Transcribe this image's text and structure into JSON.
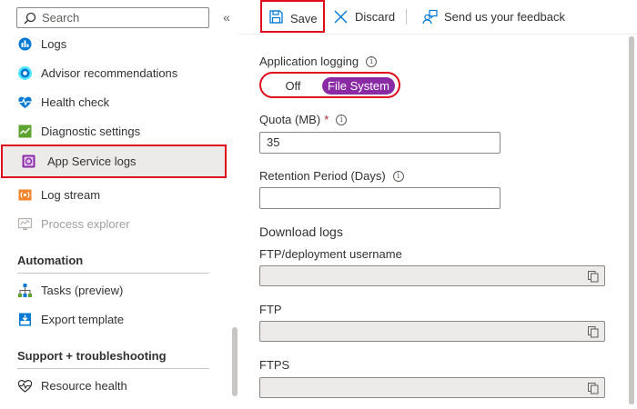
{
  "search": {
    "placeholder": "Search",
    "icon": "search-icon"
  },
  "sidebar": {
    "collapse_glyph": "«",
    "items": [
      {
        "label": "Logs",
        "icon": "logs-icon"
      },
      {
        "label": "Advisor recommendations",
        "icon": "advisor-icon"
      },
      {
        "label": "Health check",
        "icon": "health-check-icon"
      },
      {
        "label": "Diagnostic settings",
        "icon": "diagnostic-settings-icon"
      },
      {
        "label": "App Service logs",
        "icon": "app-service-logs-icon",
        "selected": true
      },
      {
        "label": "Log stream",
        "icon": "log-stream-icon"
      },
      {
        "label": "Process explorer",
        "icon": "process-explorer-icon",
        "disabled": true
      }
    ],
    "sections": [
      {
        "title": "Automation",
        "items": [
          {
            "label": "Tasks (preview)",
            "icon": "tasks-icon"
          },
          {
            "label": "Export template",
            "icon": "export-template-icon"
          }
        ]
      },
      {
        "title": "Support + troubleshooting",
        "items": [
          {
            "label": "Resource health",
            "icon": "resource-health-icon"
          }
        ]
      }
    ]
  },
  "toolbar": {
    "save_label": "Save",
    "discard_label": "Discard",
    "feedback_label": "Send us your feedback"
  },
  "form": {
    "app_logging_label": "Application logging",
    "toggle_off": "Off",
    "toggle_on": "File System",
    "quota_label": "Quota (MB)",
    "quota_required": "*",
    "quota_value": "35",
    "retention_label": "Retention Period (Days)",
    "retention_value": "",
    "download_logs_title": "Download logs",
    "ftp_user_label": "FTP/deployment username",
    "ftp_label": "FTP",
    "ftps_label": "FTPS",
    "info_glyph": "i"
  },
  "colors": {
    "accent_purple": "#8a2aa4",
    "highlight_red": "#e00b1c",
    "azure_blue": "#0078d4"
  }
}
